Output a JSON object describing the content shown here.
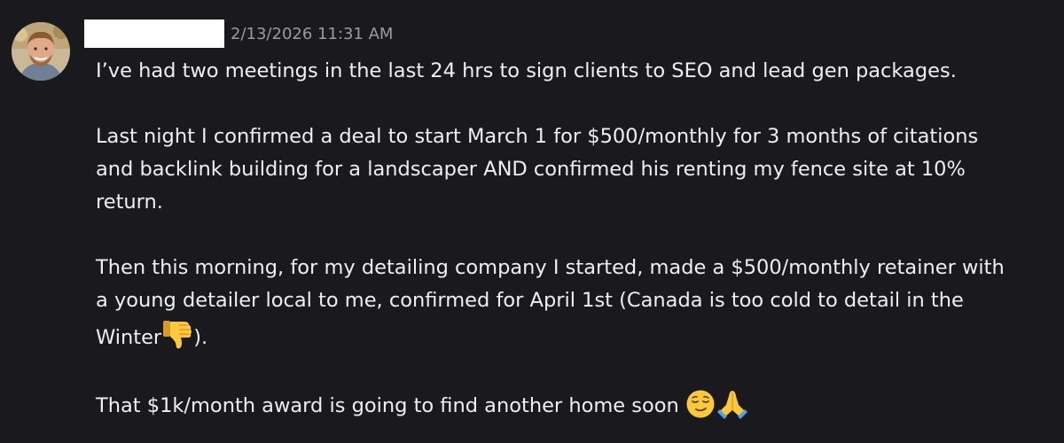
{
  "message": {
    "timestamp": "2/13/2026 11:31 AM",
    "paragraphs": {
      "p1": "I’ve had two meetings in the last 24 hrs to sign clients to SEO and lead gen packages.",
      "p2_line1": "Last night I confirmed a deal to start March 1 for $500/monthly for 3 months of citations",
      "p2_line2": "and backlink building for a landscaper AND confirmed his renting my fence site at 10%",
      "p2_line3": "return.",
      "p3_line1": "Then this morning, for my detailing company I started, made a $500/monthly retainer  with",
      "p3_line2": "a young detailer local to me, confirmed for April 1st (Canada is too cold to detail in the",
      "p3_line3_start": "Winter",
      "p3_line3_end": ").",
      "p4": "That $1k/month award is going to find another home soon"
    },
    "emojis": {
      "thumbs_down": "thumbs-down-icon",
      "relieved": "relieved-face-icon",
      "praying": "folded-hands-icon"
    }
  }
}
